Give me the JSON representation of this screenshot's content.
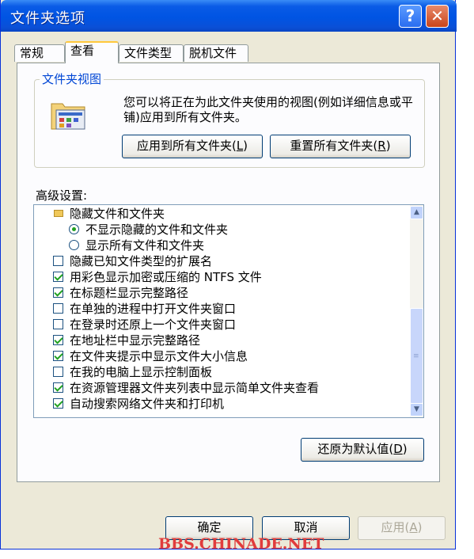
{
  "window": {
    "title": "文件夹选项"
  },
  "titlebar": {
    "help_label": "?",
    "close_label": "✕"
  },
  "tabs": [
    {
      "label": "常规",
      "active": false
    },
    {
      "label": "查看",
      "active": true
    },
    {
      "label": "文件类型",
      "active": false
    },
    {
      "label": "脱机文件",
      "active": false
    }
  ],
  "folder_views": {
    "group_title": "文件夹视图",
    "description": "您可以将正在为此文件夹使用的视图(例如详细信息或平铺)应用到所有文件夹。",
    "apply_all": {
      "text": "应用到所有文件夹(",
      "key": "L",
      "tail": ")"
    },
    "reset_all": {
      "text": "重置所有文件夹(",
      "key": "R",
      "tail": ")"
    }
  },
  "advanced": {
    "label": "高级设置:",
    "items": [
      {
        "type": "folder",
        "label": "隐藏文件和文件夹"
      },
      {
        "type": "radio",
        "label": "不显示隐藏的文件和文件夹",
        "checked": true,
        "indent": 1
      },
      {
        "type": "radio",
        "label": "显示所有文件和文件夹",
        "checked": false,
        "indent": 1
      },
      {
        "type": "checkbox",
        "label": "隐藏已知文件类型的扩展名",
        "checked": false
      },
      {
        "type": "checkbox",
        "label": "用彩色显示加密或压缩的 NTFS 文件",
        "checked": true
      },
      {
        "type": "checkbox",
        "label": "在标题栏显示完整路径",
        "checked": true
      },
      {
        "type": "checkbox",
        "label": "在单独的进程中打开文件夹窗口",
        "checked": false
      },
      {
        "type": "checkbox",
        "label": "在登录时还原上一个文件夹窗口",
        "checked": false
      },
      {
        "type": "checkbox",
        "label": "在地址栏中显示完整路径",
        "checked": true
      },
      {
        "type": "checkbox",
        "label": "在文件夹提示中显示文件大小信息",
        "checked": true
      },
      {
        "type": "checkbox",
        "label": "在我的电脑上显示控制面板",
        "checked": false
      },
      {
        "type": "checkbox",
        "label": "在资源管理器文件夹列表中显示简单文件夹查看",
        "checked": true
      },
      {
        "type": "checkbox",
        "label": "自动搜索网络文件夹和打印机",
        "checked": true
      }
    ],
    "restore_defaults": {
      "text": "还原为默认值(",
      "key": "D",
      "tail": ")"
    }
  },
  "footer": {
    "ok_label": "确定",
    "cancel_label": "取消",
    "apply": {
      "text": "应用(",
      "key": "A",
      "tail": ")"
    }
  },
  "watermark": "BBS.CHINADE.NET",
  "colors": {
    "title_bar": "#0054e3",
    "check": "#21a121",
    "group_title": "#0046d5",
    "watermark": "#e13c3c"
  }
}
